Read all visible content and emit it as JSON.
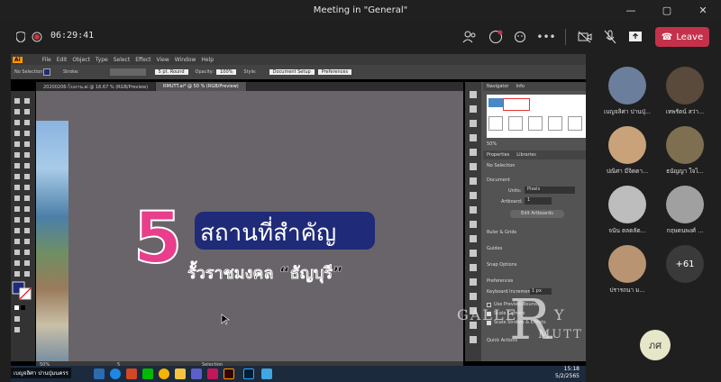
{
  "window": {
    "title": "Meeting in \"General\"",
    "controls": [
      "—",
      "▢",
      "✕"
    ]
  },
  "meeting": {
    "timer": "06:29:41",
    "leave_label": "Leave"
  },
  "illustrator": {
    "menus": [
      "Ai",
      "File",
      "Edit",
      "Object",
      "Type",
      "Select",
      "Effect",
      "View",
      "Window",
      "Help"
    ],
    "control_bar": {
      "selection": "No Selection",
      "stroke_label": "Stroke:",
      "brush": "5 pt. Round",
      "opacity_label": "Opacity:",
      "opacity_value": "100%",
      "style_label": "Style:",
      "doc_setup": "Document Setup",
      "preferences": "Preferences"
    },
    "tabs": [
      {
        "label": "20200206-โรงงาน.ai @ 16.67 % (RGB/Preview)",
        "active": false
      },
      {
        "label": "RMUTT.ai* @ 50 % (RGB/Preview)",
        "active": true
      }
    ],
    "artwork": {
      "number": "5",
      "headline": "สถานที่สำคัญ",
      "subline": "รั้วราชมงคล “ธัญบุรี”"
    },
    "status": {
      "zoom": "50%",
      "page": "5",
      "tool": "Selection"
    },
    "panel": {
      "navigator_tab": "Navigator",
      "info_tab": "Info",
      "nav_zoom": "50%",
      "properties_tab": "Properties",
      "libraries_tab": "Libraries",
      "no_selection": "No Selection",
      "document_label": "Document",
      "units_label": "Units:",
      "units_value": "Pixels",
      "artboard_label": "Artboard:",
      "artboard_value": "1",
      "edit_artboards": "Edit Artboards",
      "ruler_grids": "Ruler & Grids",
      "guides": "Guides",
      "snap": "Snap Options",
      "preferences_label": "Preferences",
      "keyboard_increment_label": "Keyboard Increment:",
      "keyboard_increment_value": "1 px",
      "use_preview_bounds": "Use Preview Bounds",
      "scale_corners": "Scale Corners",
      "scale_strokes": "Scale Strokes & Effects",
      "quick_actions": "Quick Actions"
    },
    "overlay_name": "เบญจลิศา ปานปุ่มนครร"
  },
  "watermark": {
    "left": "GALLE",
    "right": "Y",
    "bottom": "MUTT",
    "letter": "R"
  },
  "taskbar": {
    "time": "15:18",
    "date": "5/2/2565"
  },
  "participants": [
    {
      "name": "เบญจลิศา ปานปุ่...",
      "color": "#6b7f9c"
    },
    {
      "name": "เทพรัตน์ สว่า...",
      "color": "#5a4a3c"
    },
    {
      "name": "ปณิศา มีจิตตา...",
      "color": "#c9a27a"
    },
    {
      "name": "ธนัญญา ใจไ...",
      "color": "#7d6f4f"
    },
    {
      "name": "จนัน ตลตลัต...",
      "color": "#bdbdbd"
    },
    {
      "name": "กฤษดนพงศ์ ...",
      "color": "#a0a0a0"
    },
    {
      "name": "ปรารถนา ม...",
      "color": "#b89472"
    }
  ],
  "more_count": "+61",
  "self_initials": "ภศ",
  "colors": {
    "leave": "#c4314b",
    "headline_bg": "#1f2a78",
    "number_pink": "#e83e8c",
    "self_avatar": "#e6e6c8"
  }
}
